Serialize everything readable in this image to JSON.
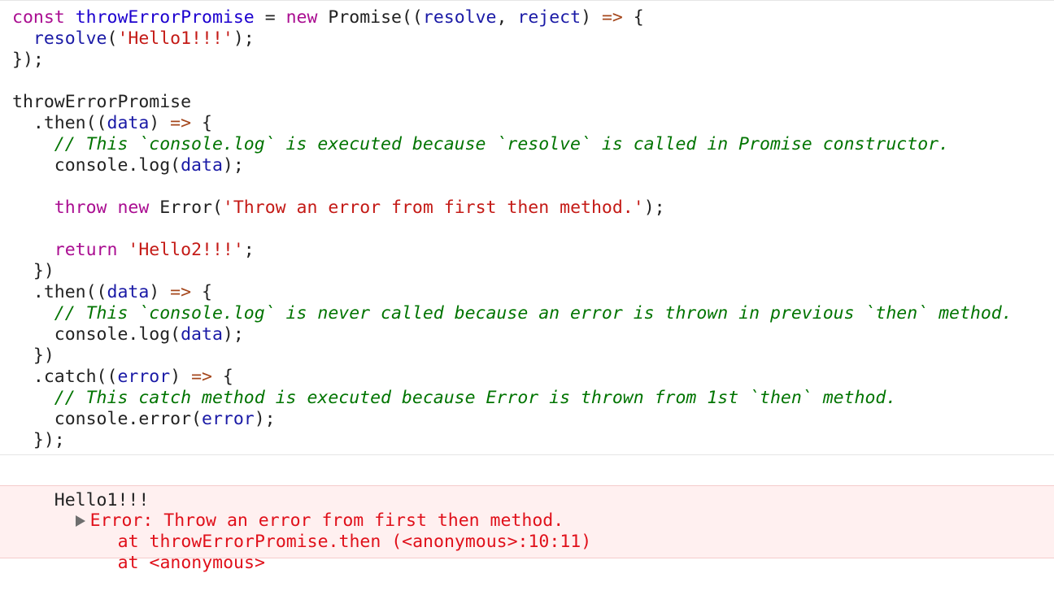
{
  "code": {
    "lines": [
      [
        {
          "t": "const",
          "c": "kw"
        },
        {
          "t": " ",
          "c": "plain"
        },
        {
          "t": "throwErrorPromise",
          "c": "var"
        },
        {
          "t": " = ",
          "c": "plain"
        },
        {
          "t": "new",
          "c": "kw"
        },
        {
          "t": " Promise((",
          "c": "plain"
        },
        {
          "t": "resolve",
          "c": "param"
        },
        {
          "t": ", ",
          "c": "plain"
        },
        {
          "t": "reject",
          "c": "param"
        },
        {
          "t": ") ",
          "c": "plain"
        },
        {
          "t": "=>",
          "c": "arrow"
        },
        {
          "t": " {",
          "c": "plain"
        }
      ],
      [
        {
          "t": "  ",
          "c": "plain"
        },
        {
          "t": "resolve",
          "c": "param"
        },
        {
          "t": "(",
          "c": "plain"
        },
        {
          "t": "'Hello1!!!'",
          "c": "str"
        },
        {
          "t": ");",
          "c": "plain"
        }
      ],
      [
        {
          "t": "});",
          "c": "plain"
        }
      ],
      [
        {
          "t": "",
          "c": "plain"
        }
      ],
      [
        {
          "t": "throwErrorPromise",
          "c": "plain"
        }
      ],
      [
        {
          "t": "  .then((",
          "c": "plain"
        },
        {
          "t": "data",
          "c": "param"
        },
        {
          "t": ") ",
          "c": "plain"
        },
        {
          "t": "=>",
          "c": "arrow"
        },
        {
          "t": " {",
          "c": "plain"
        }
      ],
      [
        {
          "t": "    ",
          "c": "plain"
        },
        {
          "t": "// This `console.log` is executed because `resolve` is called in Promise constructor.",
          "c": "cm"
        }
      ],
      [
        {
          "t": "    console.log(",
          "c": "plain"
        },
        {
          "t": "data",
          "c": "param"
        },
        {
          "t": ");",
          "c": "plain"
        }
      ],
      [
        {
          "t": "",
          "c": "plain"
        }
      ],
      [
        {
          "t": "    ",
          "c": "plain"
        },
        {
          "t": "throw",
          "c": "kw"
        },
        {
          "t": " ",
          "c": "plain"
        },
        {
          "t": "new",
          "c": "kw"
        },
        {
          "t": " Error(",
          "c": "plain"
        },
        {
          "t": "'Throw an error from first then method.'",
          "c": "str"
        },
        {
          "t": ");",
          "c": "plain"
        }
      ],
      [
        {
          "t": "",
          "c": "plain"
        }
      ],
      [
        {
          "t": "    ",
          "c": "plain"
        },
        {
          "t": "return",
          "c": "kw"
        },
        {
          "t": " ",
          "c": "plain"
        },
        {
          "t": "'Hello2!!!'",
          "c": "str"
        },
        {
          "t": ";",
          "c": "plain"
        }
      ],
      [
        {
          "t": "  })",
          "c": "plain"
        }
      ],
      [
        {
          "t": "  .then((",
          "c": "plain"
        },
        {
          "t": "data",
          "c": "param"
        },
        {
          "t": ") ",
          "c": "plain"
        },
        {
          "t": "=>",
          "c": "arrow"
        },
        {
          "t": " {",
          "c": "plain"
        }
      ],
      [
        {
          "t": "    ",
          "c": "plain"
        },
        {
          "t": "// This `console.log` is never called because an error is thrown in previous `then` method.",
          "c": "cm"
        }
      ],
      [
        {
          "t": "    console.log(",
          "c": "plain"
        },
        {
          "t": "data",
          "c": "param"
        },
        {
          "t": ");",
          "c": "plain"
        }
      ],
      [
        {
          "t": "  })",
          "c": "plain"
        }
      ],
      [
        {
          "t": "  .catch((",
          "c": "plain"
        },
        {
          "t": "error",
          "c": "param"
        },
        {
          "t": ") ",
          "c": "plain"
        },
        {
          "t": "=>",
          "c": "arrow"
        },
        {
          "t": " {",
          "c": "plain"
        }
      ],
      [
        {
          "t": "    ",
          "c": "plain"
        },
        {
          "t": "// This catch method is executed because Error is thrown from 1st `then` method.",
          "c": "cm"
        }
      ],
      [
        {
          "t": "    console.error(",
          "c": "plain"
        },
        {
          "t": "error",
          "c": "param"
        },
        {
          "t": ");",
          "c": "plain"
        }
      ],
      [
        {
          "t": "  });",
          "c": "plain"
        }
      ]
    ]
  },
  "output": {
    "log_text": "Hello1!!!",
    "error": {
      "message": "Error: Throw an error from first then method.",
      "stack": [
        "at throwErrorPromise.then (<anonymous>:10:11)",
        "at <anonymous>"
      ],
      "expand_icon": "disclosure-triangle-icon"
    }
  },
  "colors": {
    "keyword": "#aa0d91",
    "identifier": "#1c00cf",
    "param": "#1a1aa6",
    "string": "#c41a16",
    "comment": "#007400",
    "error_text": "#e0101a",
    "error_bg": "#fff0f0"
  }
}
